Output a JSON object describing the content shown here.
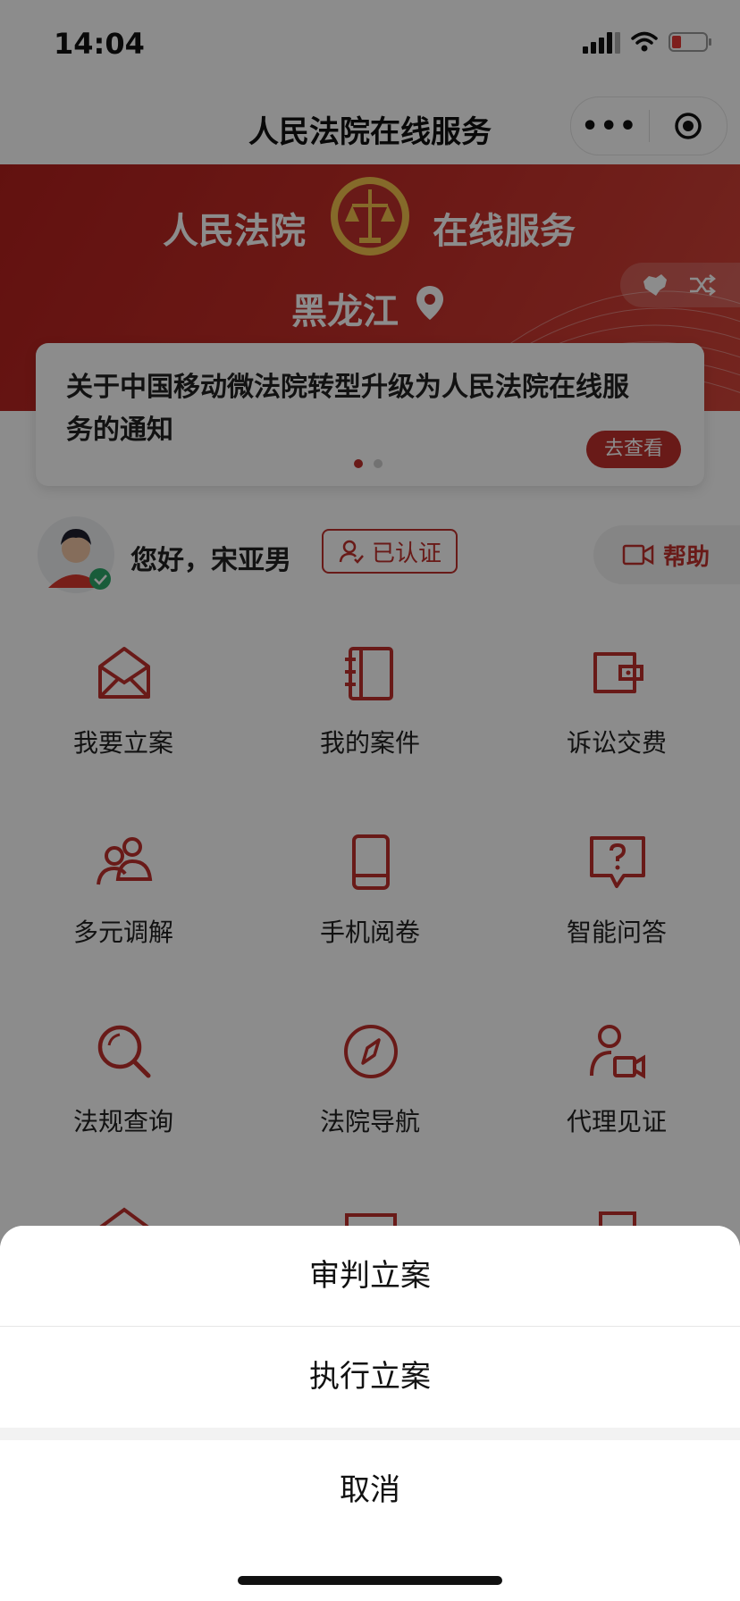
{
  "status_bar": {
    "time": "14:04"
  },
  "nav": {
    "title": "人民法院在线服务",
    "more_icon": "more-dots-icon",
    "close_icon": "target-circle-icon"
  },
  "banner": {
    "left_text": "人民法院",
    "right_text": "在线服务",
    "province": "黑龙江",
    "emblem_icon": "court-emblem-icon",
    "location_icon": "location-pin-icon",
    "switch_icons": [
      "china-map-icon",
      "shuffle-icon"
    ]
  },
  "notice": {
    "text": "关于中国移动微法院转型升级为人民法院在线服务的通知",
    "button": "去查看",
    "page_count": 2,
    "active_page": 1
  },
  "user": {
    "greeting": "您好，宋亚男",
    "verified_label": "已认证",
    "help_label": "帮助"
  },
  "services": [
    {
      "label": "我要立案",
      "icon": "envelope-icon"
    },
    {
      "label": "我的案件",
      "icon": "notebook-icon"
    },
    {
      "label": "诉讼交费",
      "icon": "wallet-icon"
    },
    {
      "label": "多元调解",
      "icon": "people-icon"
    },
    {
      "label": "手机阅卷",
      "icon": "mobile-icon"
    },
    {
      "label": "智能问答",
      "icon": "question-bubble-icon"
    },
    {
      "label": "法规查询",
      "icon": "search-icon"
    },
    {
      "label": "法院导航",
      "icon": "compass-icon"
    },
    {
      "label": "代理见证",
      "icon": "user-video-icon"
    }
  ],
  "action_sheet": {
    "options": [
      "审判立案",
      "执行立案"
    ],
    "cancel": "取消"
  },
  "colors": {
    "brand_red": "#c0312c",
    "overlay": "rgba(0,0,0,0.45)"
  }
}
